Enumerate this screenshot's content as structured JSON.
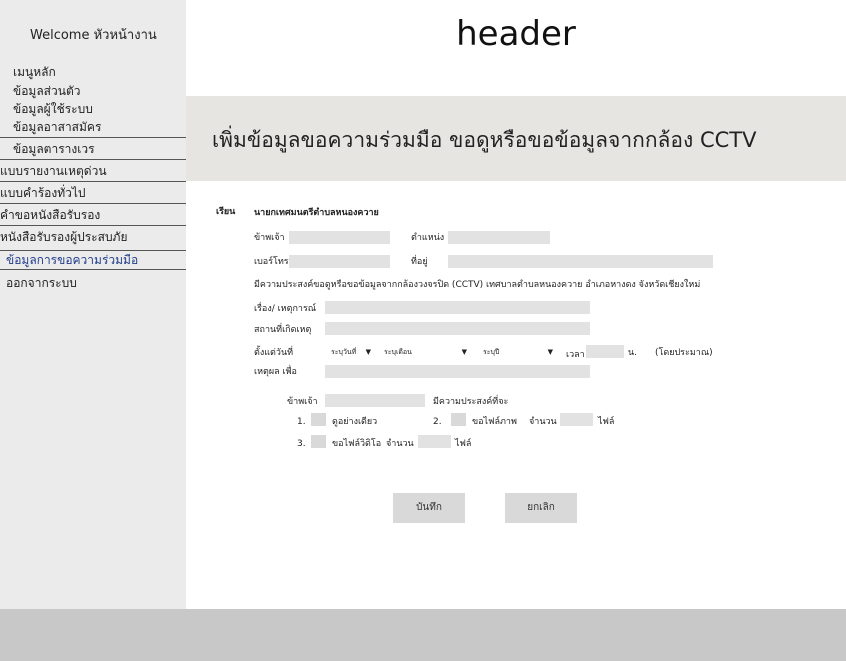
{
  "sidebar": {
    "welcome": "Welcome หัวหน้างาน",
    "items": [
      {
        "label": "เมนูหลัก"
      },
      {
        "label": "ข้อมูลส่วนตัว"
      },
      {
        "label": "ข้อมูลผู้ใช้ระบบ"
      },
      {
        "label": "ข้อมูลอาสาสมัคร"
      },
      {
        "label": "ข้อมูลตารางเวร"
      },
      {
        "label": "แบบรายงานเหตุด่วน"
      },
      {
        "label": "แบบคำร้องทั่วไป"
      },
      {
        "label": "คำขอหนังสือรับรอง"
      },
      {
        "label": "หนังสือรับรองผู้ประสบภัย"
      },
      {
        "label": "ข้อมูลการขอความร่วมมือ"
      },
      {
        "label": "ออกจากระบบ"
      }
    ]
  },
  "header": {
    "title": "header"
  },
  "page": {
    "title": "เพิ่มข้อมูลขอความร่วมมือ ขอดูหรือขอข้อมูลจากกล้อง CCTV"
  },
  "form": {
    "salutation_label": "เรียน",
    "salutation_value": "นายกเทศมนตรีตำบลหนองควาย",
    "i_label": "ข้าพเจ้า",
    "position_label": "ตำแหน่ง",
    "phone_label": "เบอร์โทร",
    "address_label": "ที่อยู่",
    "purpose_text": "มีความประสงค์ขอดูหรือขอข้อมูลจากกล้องวงจรปิด (CCTV) เทศบาลตำบลหนองควาย อำเภอหางดง จังหวัดเชียงใหม่",
    "subject_label": "เรื่อง/ เหตุการณ์",
    "location_label": "สถานที่เกิดเหตุ",
    "since_label": "ตั้งแต่วันที่",
    "day_select": "ระบุวันที่",
    "month_select": "ระบุเดือน",
    "year_select": "ระบุปี",
    "time_label": "เวลา",
    "time_unit": "น.",
    "approx": "(โดยประมาณ)",
    "reason_label": "เหตุผล เพื่อ",
    "i_label2": "ข้าพเจ้า",
    "intend_label": "มีความประสงค์ที่จะ",
    "opt1_num": "1.",
    "opt1_label": "ดูอย่างเดียว",
    "opt2_num": "2.",
    "opt2_label": "ขอไฟล์ภาพ",
    "opt2_count_label": "จำนวน",
    "opt2_unit": "ไฟล์",
    "opt3_num": "3.",
    "opt3_label": "ขอไฟล์วิดิโอ",
    "opt3_count_label": "จำนวน",
    "opt3_unit": "ไฟล์",
    "save_button": "บันทึก",
    "cancel_button": "ยกเลิก"
  }
}
